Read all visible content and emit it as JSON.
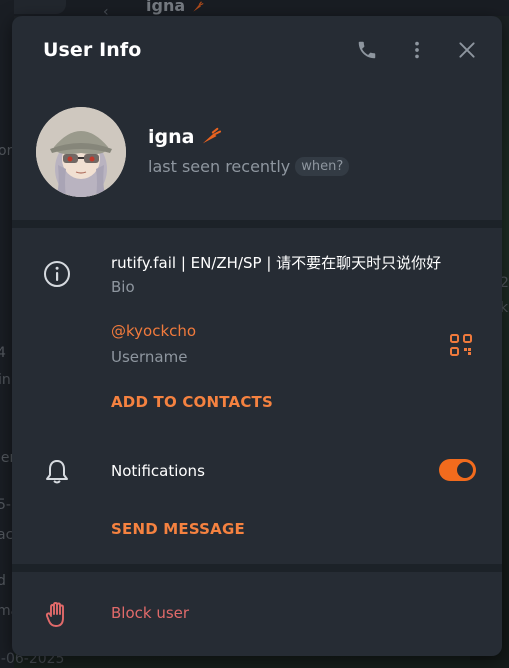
{
  "background": {
    "chat_title": "igna",
    "fragments": [
      "or",
      "k",
      "in",
      "ler",
      "5-",
      "ac",
      "d",
      "ma",
      "0-06-2025",
      "4",
      "2"
    ]
  },
  "modal": {
    "title": "User Info",
    "header_icons": [
      "phone-icon",
      "more-vertical-icon",
      "close-icon"
    ],
    "user": {
      "name": "igna",
      "name_emoji_icon": "carrot-icon",
      "status": "last seen recently",
      "when_label": "when?"
    },
    "bio": {
      "value": "rutify.fail | EN/ZH/SP | 请不要在聊天时只说你好",
      "label": "Bio"
    },
    "username": {
      "value": "@kyockcho",
      "label": "Username"
    },
    "add_contacts_label": "ADD TO CONTACTS",
    "notifications": {
      "label": "Notifications",
      "enabled": true
    },
    "send_message_label": "SEND MESSAGE",
    "block_user_label": "Block user"
  },
  "colors": {
    "accent": "#f58240",
    "toggle": "#f26b1d",
    "danger": "#e16a6a",
    "panel": "#262c34"
  }
}
